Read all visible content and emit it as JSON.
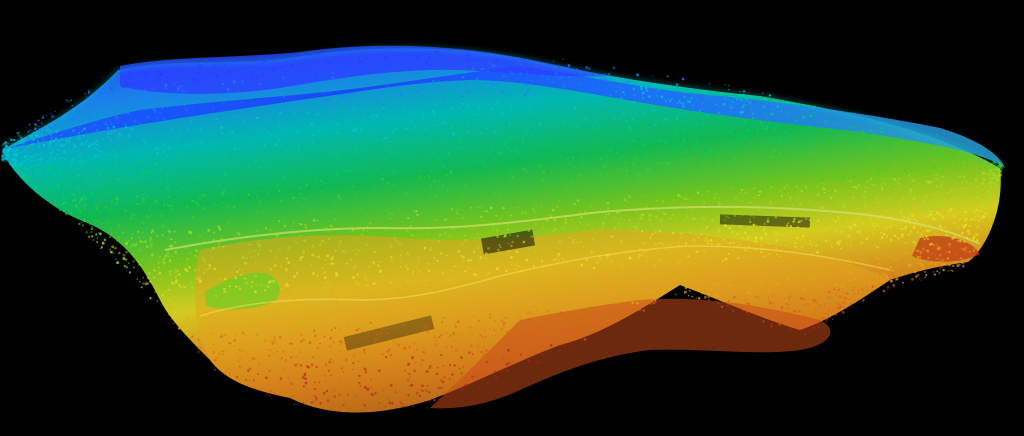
{
  "scene": {
    "subject": "",
    "background_color": "#000000",
    "color_ramp": [
      "#1f3fff",
      "#1c7dff",
      "#00c8d8",
      "#00d070",
      "#3fd02a",
      "#a8e020",
      "#f0e020",
      "#f0a020",
      "#e05a1a",
      "#b8241a"
    ],
    "point_density": 5200
  }
}
